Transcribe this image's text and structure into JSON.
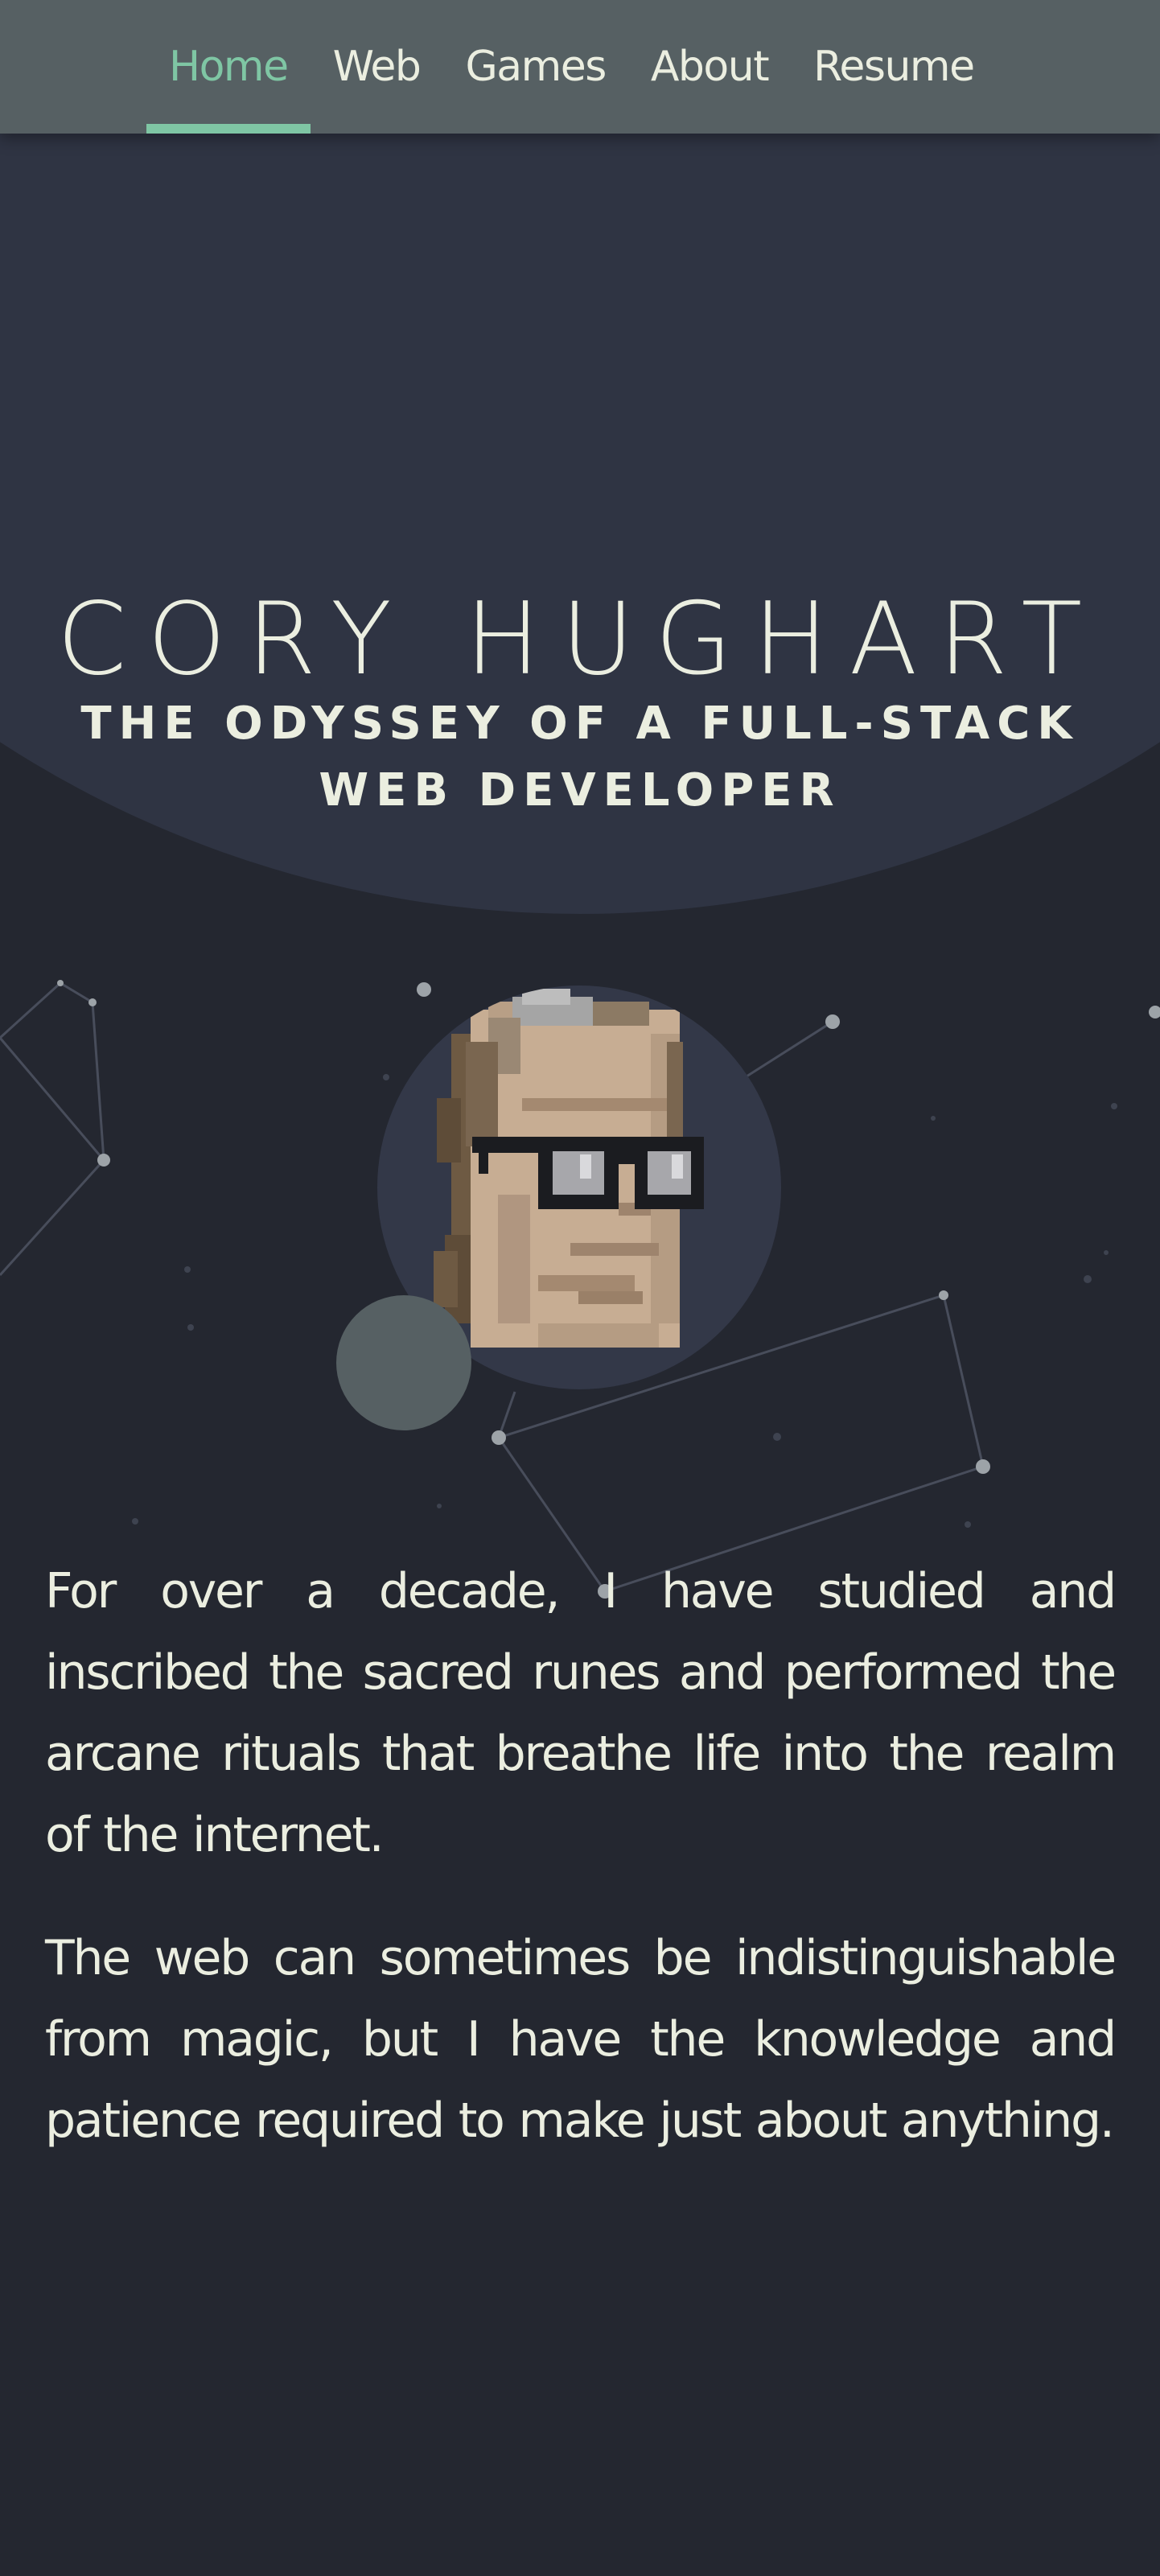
{
  "nav": {
    "items": [
      {
        "label": "Home",
        "active": true
      },
      {
        "label": "Web",
        "active": false
      },
      {
        "label": "Games",
        "active": false
      },
      {
        "label": "About",
        "active": false
      },
      {
        "label": "Resume",
        "active": false
      }
    ]
  },
  "hero": {
    "title": "CORY HUGHART",
    "subtitle": "THE ODYSSEY OF A FULL-STACK WEB DEVELOPER"
  },
  "intro": {
    "paragraphs": [
      "For over a decade, I have studied and inscribed the sacred runes and performed the arcane rituals that breathe life into the realm of the internet.",
      "The web can sometimes be indistinguishable from magic, but I have the knowledge and patience required to make just about anything."
    ]
  },
  "colors": {
    "nav_bg": "#566063",
    "accent": "#7fc6a4",
    "hero_bg": "#2f3443",
    "page_bg": "#242730",
    "text": "#ebeee0"
  },
  "icons": {
    "avatar": "pixel-art-portrait-icon"
  }
}
